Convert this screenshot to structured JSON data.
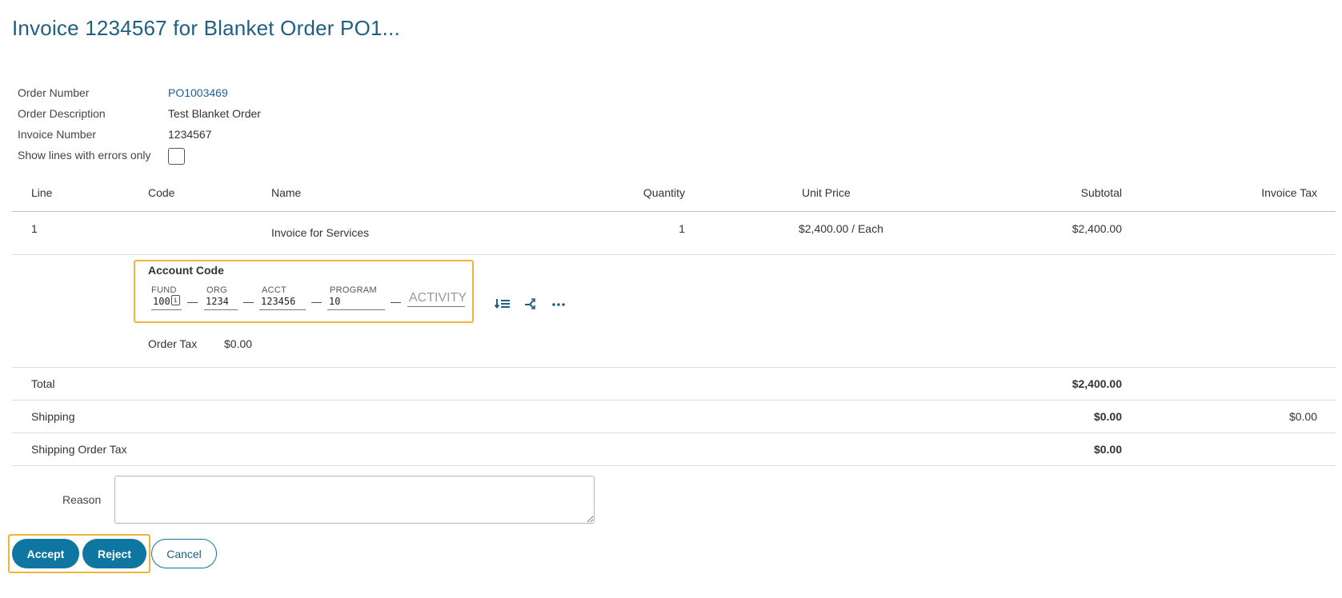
{
  "title": "Invoice 1234567 for Blanket Order PO1...",
  "meta": {
    "order_number_label": "Order Number",
    "order_number": "PO1003469",
    "order_description_label": "Order Description",
    "order_description": "Test Blanket Order",
    "invoice_number_label": "Invoice Number",
    "invoice_number": "1234567",
    "errors_only_label": "Show lines with errors only"
  },
  "table": {
    "headers": {
      "line": "Line",
      "code": "Code",
      "name": "Name",
      "quantity": "Quantity",
      "unit_price": "Unit Price",
      "subtotal": "Subtotal",
      "invoice_tax": "Invoice Tax"
    },
    "row": {
      "line": "1",
      "name": "Invoice for Services",
      "quantity": "1",
      "unit_price": "$2,400.00 / Each",
      "subtotal": "$2,400.00"
    },
    "account_code": {
      "title": "Account Code",
      "segments": [
        {
          "label": "FUND",
          "value": "100"
        },
        {
          "label": "ORG",
          "value": "1234"
        },
        {
          "label": "ACCT",
          "value": "123456"
        },
        {
          "label": "PROGRAM",
          "value": "10"
        },
        {
          "label": "",
          "placeholder": "ACTIVITY"
        }
      ],
      "separator": "—",
      "icons": [
        "list-order-icon",
        "split-icon",
        "more-icon"
      ]
    },
    "order_tax_label": "Order Tax",
    "order_tax": "$0.00",
    "total_label": "Total",
    "total": "$2,400.00",
    "shipping_label": "Shipping",
    "shipping_subtotal": "$0.00",
    "shipping_invoice_tax": "$0.00",
    "shipping_order_tax_label": "Shipping Order Tax",
    "shipping_order_tax": "$0.00"
  },
  "reason": {
    "label": "Reason",
    "value": ""
  },
  "buttons": {
    "accept": "Accept",
    "reject": "Reject",
    "cancel": "Cancel"
  },
  "colors": {
    "title": "#1f5f82",
    "primary_button": "#0e76a0",
    "highlight": "#f0b43c"
  }
}
